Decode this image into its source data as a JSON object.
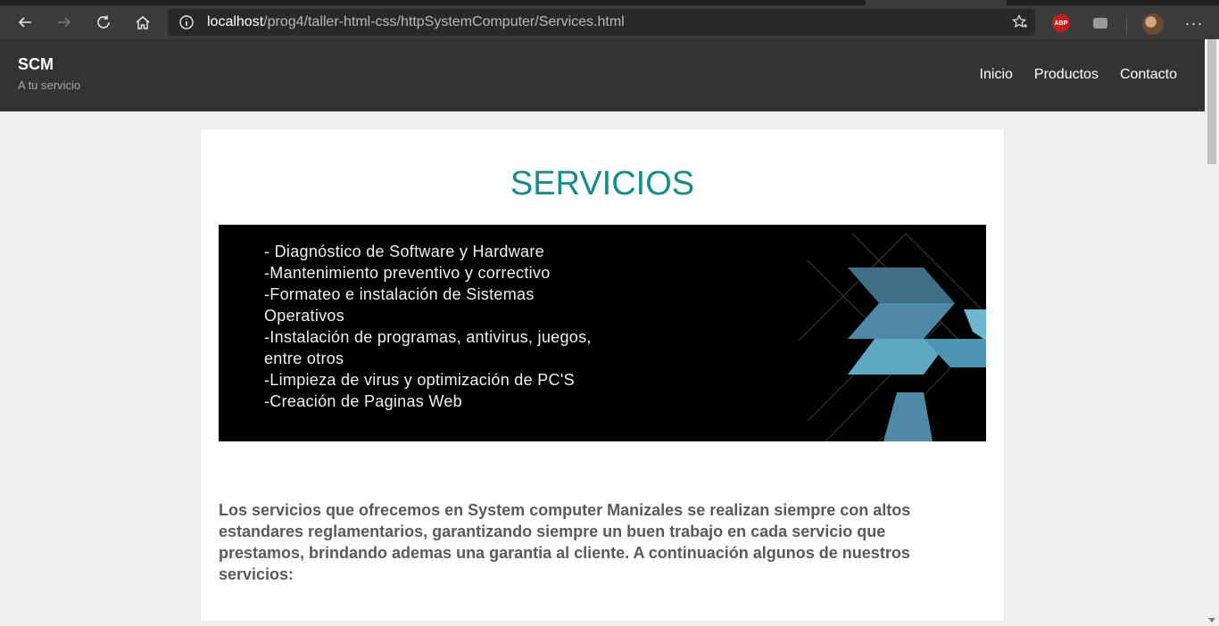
{
  "browser": {
    "url_host": "localhost",
    "url_path": "/prog4/taller-html-css/httpSystemComputer/Services.html",
    "extension_label": "ABP"
  },
  "site": {
    "brand": "SCM",
    "tagline": "A tu servicio",
    "nav": [
      {
        "label": "Inicio"
      },
      {
        "label": "Productos"
      },
      {
        "label": "Contacto"
      }
    ]
  },
  "main": {
    "title": "SERVICIOS",
    "banner_items": [
      "- Diagnóstico de Software y Hardware",
      "-Mantenimiento preventivo y correctivo",
      "-Formateo e instalación de Sistemas",
      "Operativos",
      "-Instalación de programas, antivirus, juegos,",
      "entre otros",
      "-Limpieza de virus y optimización de PC'S",
      "-Creación de Paginas Web"
    ],
    "description": "Los servicios que ofrecemos en System computer Manizales se realizan siempre con altos estandares reglamentarios, garantizando siempre un buen trabajo en cada servicio que prestamos, brindando ademas una garantia al cliente. A continuación algunos de nuestros servicios:"
  },
  "colors": {
    "header_bg": "#333333",
    "title": "#178a8a",
    "banner_shape": "#5fa8c4"
  }
}
